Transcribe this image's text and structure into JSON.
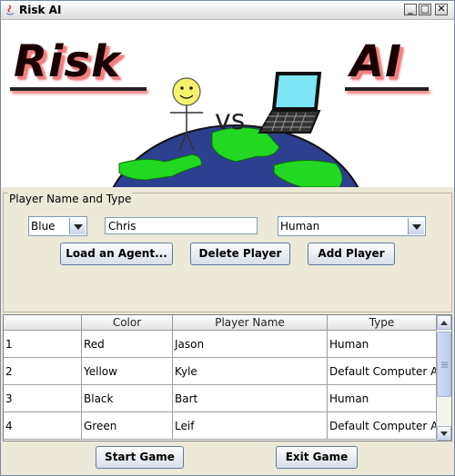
{
  "window": {
    "title": "Risk AI"
  },
  "banner": {
    "logo_left": "Risk",
    "logo_right": "AI",
    "vs": "vs"
  },
  "setup": {
    "panel_title": "Player Name and Type",
    "color_selected": "Blue",
    "name_value": "Chris",
    "type_selected": "Human",
    "load_agent_label": "Load an Agent...",
    "delete_player_label": "Delete Player",
    "add_player_label": "Add Player"
  },
  "table": {
    "columns": [
      "",
      "Color",
      "Player Name",
      "Type"
    ],
    "rows": [
      [
        "1",
        "Red",
        "Jason",
        "Human"
      ],
      [
        "2",
        "Yellow",
        "Kyle",
        "Default Computer A..."
      ],
      [
        "3",
        "Black",
        "Bart",
        "Human"
      ],
      [
        "4",
        "Green",
        "Leif",
        "Default Computer A..."
      ]
    ]
  },
  "footer": {
    "start_label": "Start Game",
    "exit_label": "Exit Game"
  },
  "colors": {
    "ocean": "#2d3f8f",
    "land": "#22d822",
    "screen": "#7fe6f6",
    "smiley": "#f6f36a"
  }
}
